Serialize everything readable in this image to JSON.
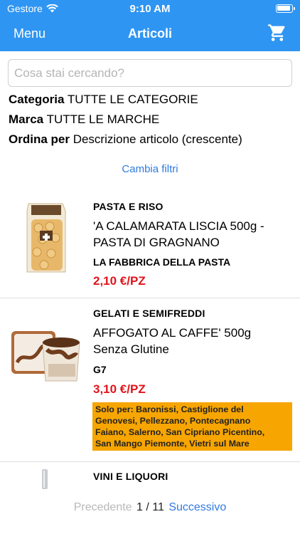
{
  "status": {
    "carrier": "Gestore",
    "time": "9:10 AM"
  },
  "nav": {
    "menu_label": "Menu",
    "title": "Articoli"
  },
  "search": {
    "placeholder": "Cosa stai cercando?",
    "value": ""
  },
  "filters": {
    "category_label": "Categoria",
    "category_value": "TUTTE LE CATEGORIE",
    "brand_label": "Marca",
    "brand_value": "TUTTE LE MARCHE",
    "sort_label": "Ordina per",
    "sort_value": "Descrizione articolo (crescente)",
    "change_label": "Cambia filtri"
  },
  "items": [
    {
      "category": "PASTA E RISO",
      "name_line1": "'A CALAMARATA LISCIA 500g -",
      "name_line2": "PASTA DI GRAGNANO",
      "brand": "LA FABBRICA DELLA PASTA",
      "price": "2,10 €/PZ"
    },
    {
      "category": "GELATI E SEMIFREDDI",
      "name_line1": "AFFOGATO AL CAFFE' 500g",
      "name_line2": "Senza Glutine",
      "brand": "G7",
      "price": "3,10 €/PZ",
      "notice_line1": "Solo per: Baronissi, Castiglione del",
      "notice_line2": "Genovesi, Pellezzano, Pontecagnano",
      "notice_line3": "Faiano, Salerno, San Cipriano Picentino,",
      "notice_line4": "San Mango Piemonte, Vietri sul Mare"
    },
    {
      "category": "VINI E LIQUORI"
    }
  ],
  "pager": {
    "prev_label": "Precedente",
    "page": "1 / 11",
    "next_label": "Successivo"
  },
  "colors": {
    "accent": "#2f95f2",
    "price": "#e0141b",
    "notice": "#f7a500",
    "link": "#2f7be0"
  }
}
